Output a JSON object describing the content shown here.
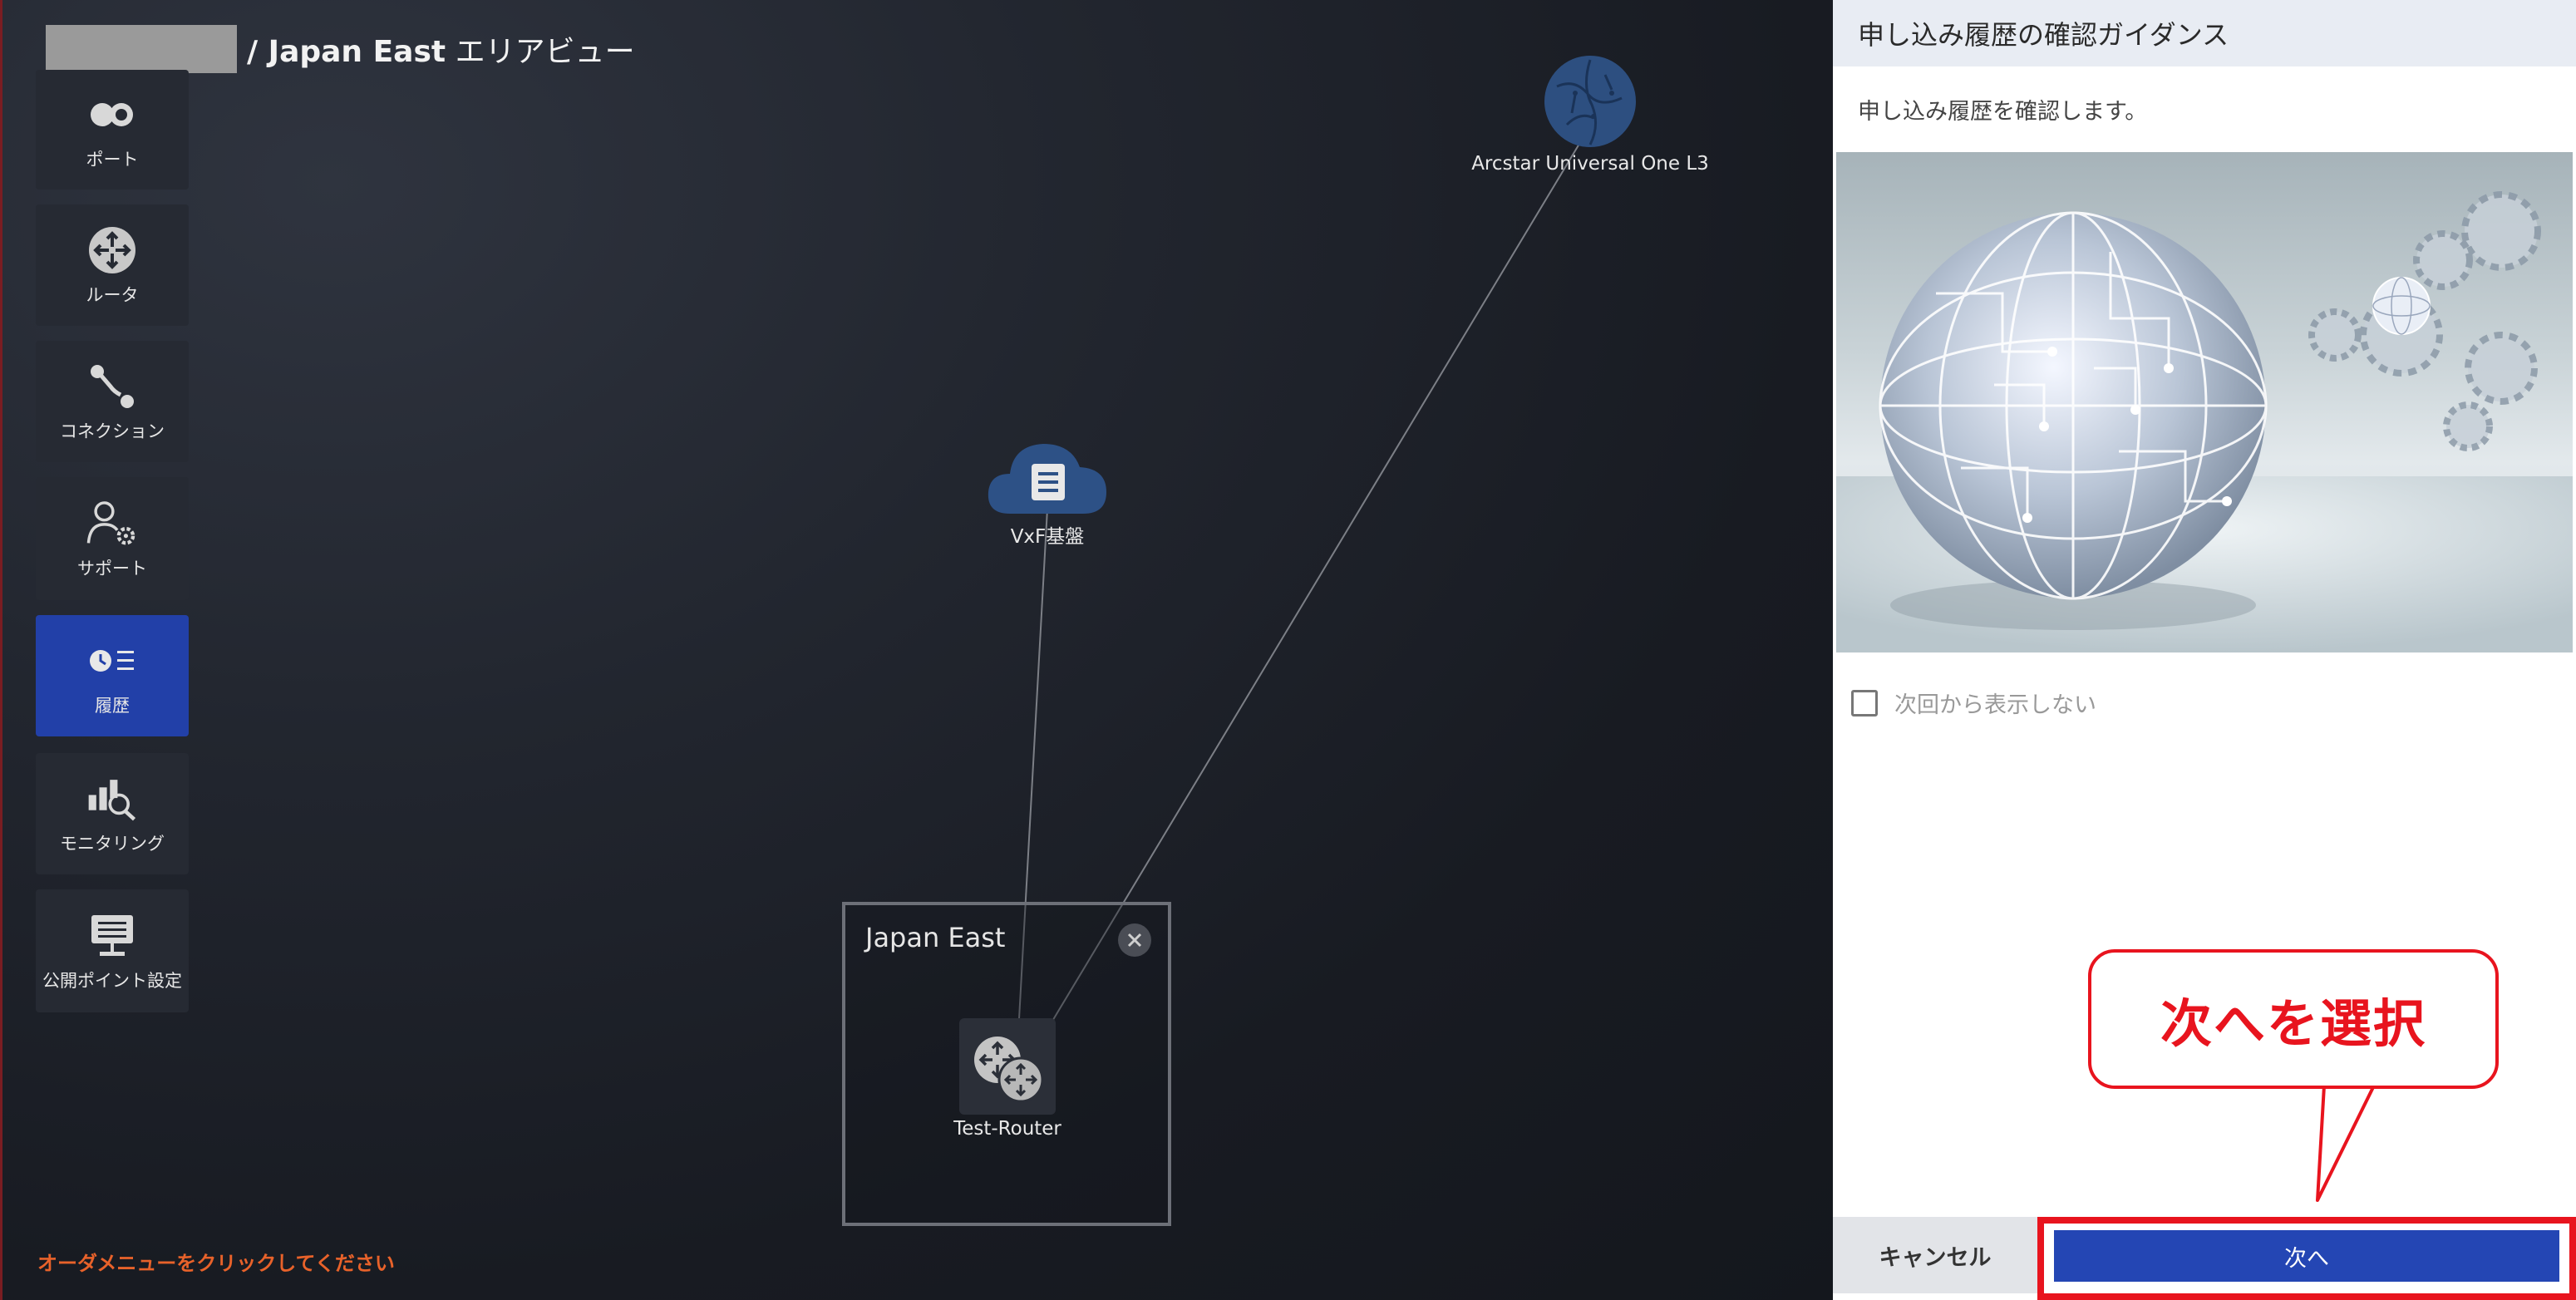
{
  "header": {
    "title_bold": "/ Japan East",
    "title_rest": " エリアビュー"
  },
  "sidebar": {
    "items": [
      {
        "label": "ポート",
        "icon": "port-icon"
      },
      {
        "label": "ルータ",
        "icon": "router-icon"
      },
      {
        "label": "コネクション",
        "icon": "connection-icon"
      },
      {
        "label": "サポート",
        "icon": "support-icon"
      },
      {
        "label": "履歴",
        "icon": "history-icon",
        "active": true
      },
      {
        "label": "モニタリング",
        "icon": "monitoring-icon"
      },
      {
        "label": "公開ポイント設定",
        "icon": "public-point-icon"
      }
    ]
  },
  "topology": {
    "nodes": {
      "arcstar": {
        "label": "Arcstar Universal One L3",
        "icon": "globe-icon"
      },
      "vxf": {
        "label": "VxF基盤",
        "icon": "cloud-icon"
      }
    },
    "area": {
      "title": "Japan East",
      "router_label": "Test-Router"
    }
  },
  "footer": {
    "hint": "オーダメニューをクリックしてください"
  },
  "panel": {
    "title": "申し込み履歴の確認ガイダンス",
    "description": "申し込み履歴を確認します。",
    "dont_show_label": "次回から表示しない",
    "cancel_label": "キャンセル",
    "next_label": "次へ"
  },
  "callout": {
    "text": "次へを選択"
  },
  "colors": {
    "accent_blue": "#2446b4",
    "sidebar_active": "#2240a8",
    "highlight_red": "#e8141e",
    "hint_orange": "#e8622a"
  }
}
